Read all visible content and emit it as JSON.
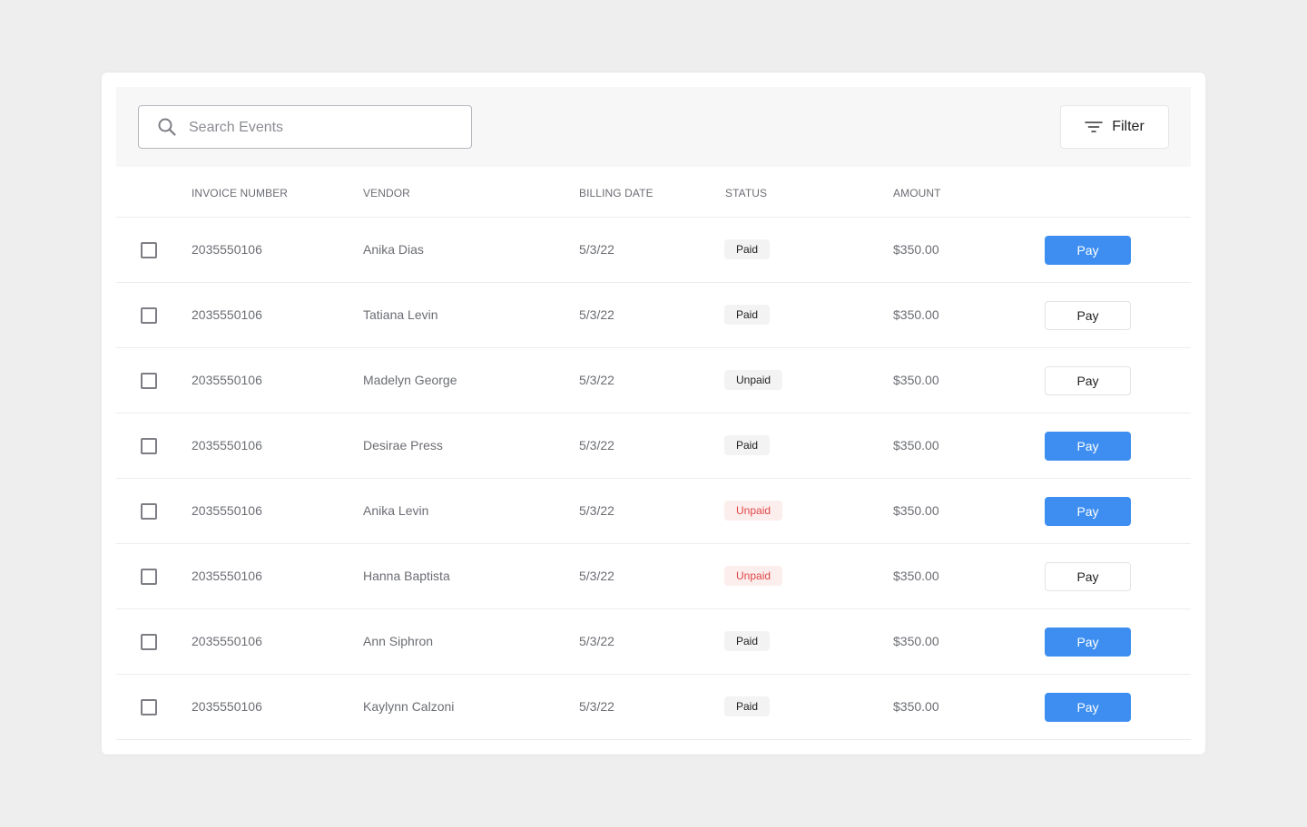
{
  "search": {
    "placeholder": "Search Events",
    "value": ""
  },
  "filter": {
    "label": "Filter"
  },
  "columns": {
    "invoice": "INVOICE NUMBER",
    "vendor": "VENDOR",
    "billing_date": "BILLING DATE",
    "status": "STATUS",
    "amount": "AMOUNT"
  },
  "colors": {
    "primary": "#3d8ef0",
    "unpaid_red": "#e04646",
    "badge_bg": "#f3f3f4"
  },
  "rows": [
    {
      "invoice": "2035550106",
      "vendor": "Anika Dias",
      "date": "5/3/22",
      "status": "Paid",
      "status_style": "neutral",
      "amount": "$350.00",
      "pay_label": "Pay",
      "pay_style": "primary"
    },
    {
      "invoice": "2035550106",
      "vendor": "Tatiana Levin",
      "date": "5/3/22",
      "status": "Paid",
      "status_style": "neutral",
      "amount": "$350.00",
      "pay_label": "Pay",
      "pay_style": "secondary"
    },
    {
      "invoice": "2035550106",
      "vendor": "Madelyn George",
      "date": "5/3/22",
      "status": "Unpaid",
      "status_style": "neutral",
      "amount": "$350.00",
      "pay_label": "Pay",
      "pay_style": "secondary"
    },
    {
      "invoice": "2035550106",
      "vendor": "Desirae Press",
      "date": "5/3/22",
      "status": "Paid",
      "status_style": "neutral",
      "amount": "$350.00",
      "pay_label": "Pay",
      "pay_style": "primary"
    },
    {
      "invoice": "2035550106",
      "vendor": "Anika Levin",
      "date": "5/3/22",
      "status": "Unpaid",
      "status_style": "red",
      "amount": "$350.00",
      "pay_label": "Pay",
      "pay_style": "primary"
    },
    {
      "invoice": "2035550106",
      "vendor": "Hanna Baptista",
      "date": "5/3/22",
      "status": "Unpaid",
      "status_style": "red",
      "amount": "$350.00",
      "pay_label": "Pay",
      "pay_style": "secondary"
    },
    {
      "invoice": "2035550106",
      "vendor": "Ann Siphron",
      "date": "5/3/22",
      "status": "Paid",
      "status_style": "neutral",
      "amount": "$350.00",
      "pay_label": "Pay",
      "pay_style": "primary"
    },
    {
      "invoice": "2035550106",
      "vendor": "Kaylynn Calzoni",
      "date": "5/3/22",
      "status": "Paid",
      "status_style": "neutral",
      "amount": "$350.00",
      "pay_label": "Pay",
      "pay_style": "primary"
    }
  ]
}
